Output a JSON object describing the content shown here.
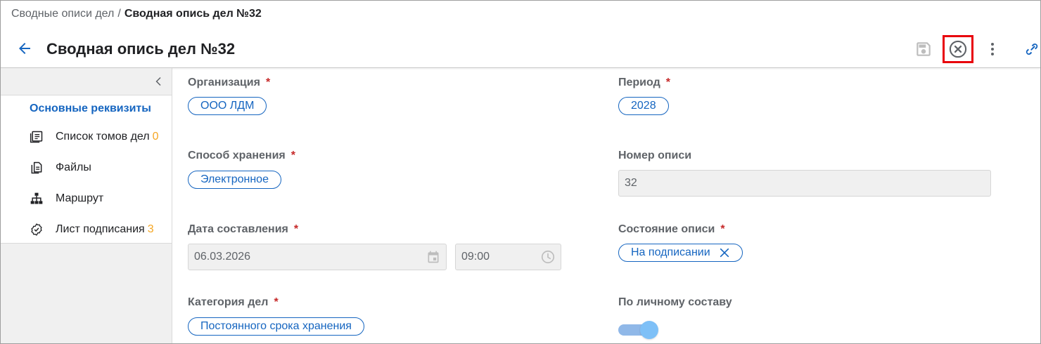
{
  "breadcrumb": {
    "parent": "Сводные описи дел",
    "separator": "/",
    "current": "Сводная опись дел №32"
  },
  "header": {
    "title": "Сводная опись дел №32",
    "icons": {
      "back": "arrow-left-icon",
      "save": "save-icon",
      "close": "close-circle-icon",
      "more": "more-vertical-icon",
      "link": "link-icon"
    }
  },
  "sidebar": {
    "active_section": "Основные реквизиты",
    "items": [
      {
        "label": "Список томов дел",
        "count": "0",
        "icon": "volumes-list-icon"
      },
      {
        "label": "Файлы",
        "count": "",
        "icon": "files-icon"
      },
      {
        "label": "Маршрут",
        "count": "",
        "icon": "route-tree-icon"
      },
      {
        "label": "Лист подписания",
        "count": "3",
        "icon": "signature-sheet-icon"
      }
    ]
  },
  "form": {
    "organization": {
      "label": "Организация",
      "required": "*",
      "value": "ООО ЛДМ"
    },
    "period": {
      "label": "Период",
      "required": "*",
      "value": "2028"
    },
    "storage_method": {
      "label": "Способ хранения",
      "required": "*",
      "value": "Электронное"
    },
    "inventory_number": {
      "label": "Номер описи",
      "value": "32"
    },
    "compile_date": {
      "label": "Дата составления",
      "required": "*",
      "date": "06.03.2026",
      "time": "09:00"
    },
    "inventory_state": {
      "label": "Состояние описи",
      "required": "*",
      "value": "На подписании"
    },
    "case_category": {
      "label": "Категория дел",
      "required": "*",
      "value": "Постоянного срока хранения"
    },
    "by_personnel": {
      "label": "По личному составу",
      "enabled": true
    }
  },
  "colors": {
    "accent": "#1565c0",
    "required": "#c62828",
    "count": "#f5a623",
    "highlight": "#e8000b"
  }
}
